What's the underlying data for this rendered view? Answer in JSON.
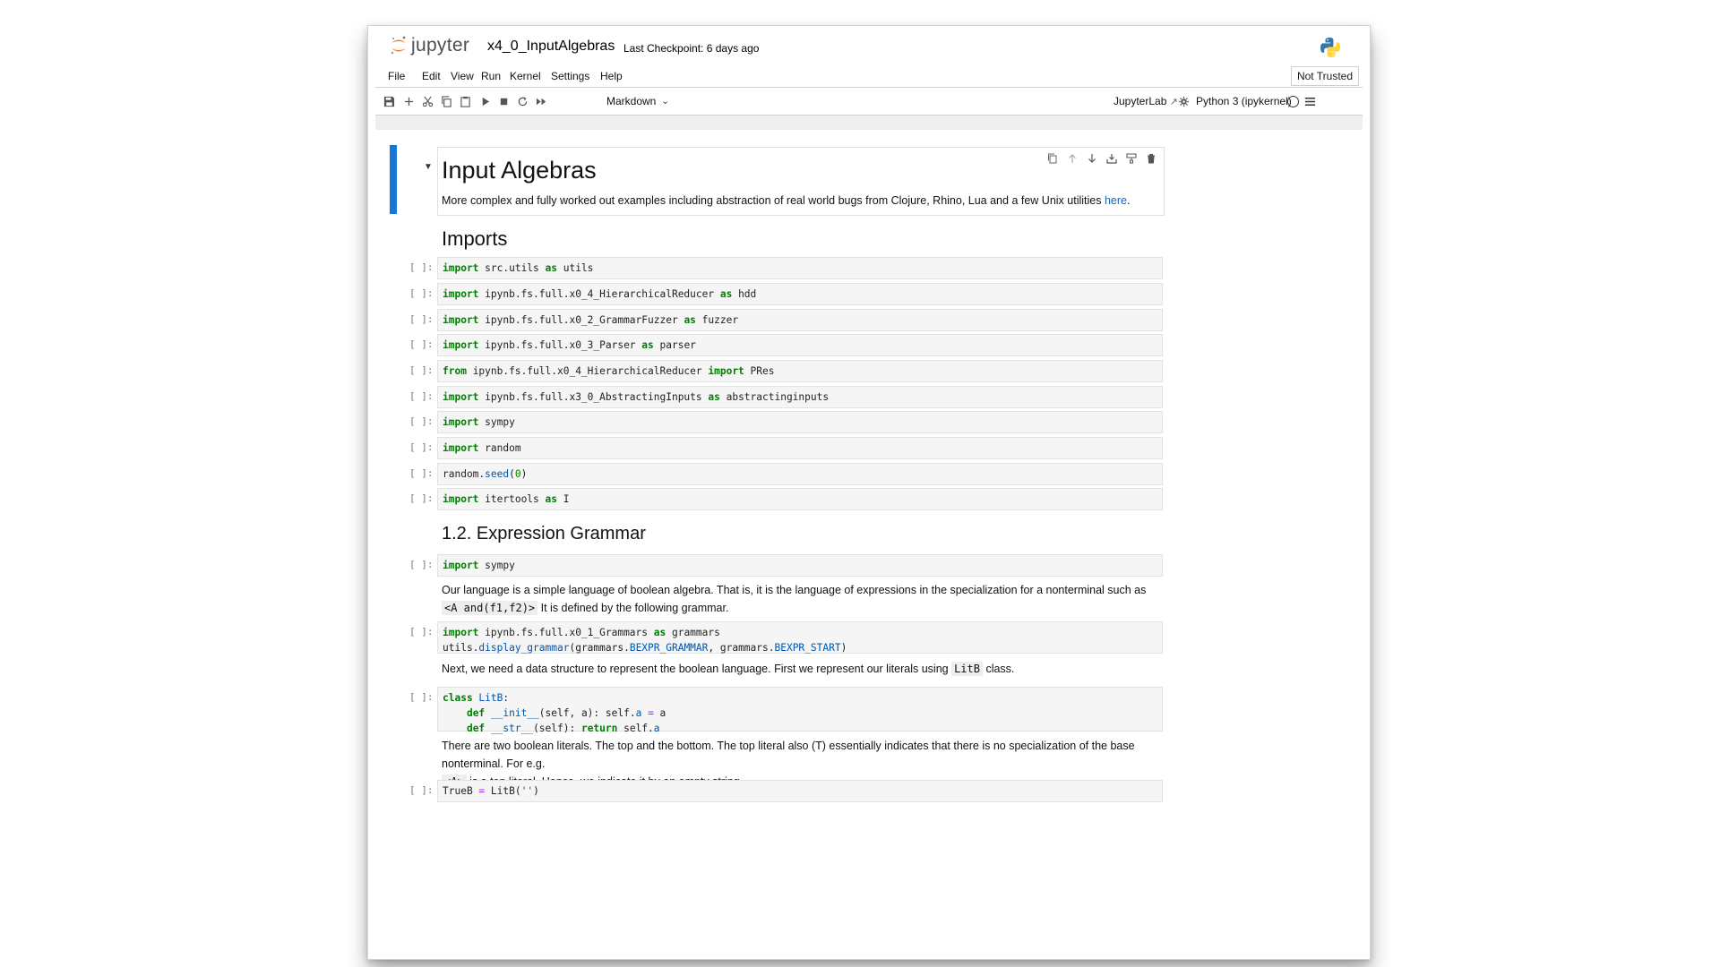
{
  "header": {
    "logo_text": "jupyter",
    "notebook_title": "x4_0_InputAlgebras",
    "checkpoint": "Last Checkpoint: 6 days ago"
  },
  "menu": {
    "items": [
      "File",
      "Edit",
      "View",
      "Run",
      "Kernel",
      "Settings",
      "Help"
    ],
    "trust_status": "Not Trusted"
  },
  "toolbar": {
    "cell_type": "Markdown",
    "jupyterlab_label": "JupyterLab",
    "kernel_name": "Python 3 (ipykernel)"
  },
  "cells": {
    "intro_heading": "Input Algebras",
    "intro_text": "More complex and fully worked out examples including abstraction of real world bugs from Clojure, Rhino, Lua and a few Unix utilities ",
    "intro_link": "here",
    "imports_heading": "Imports",
    "prompt": "[ ]:",
    "grammar_heading": "1.2. Expression Grammar",
    "lang_text_1": "Our language is a simple language of boolean algebra. That is, it is the language of expressions in the specialization for a nonterminal such as ",
    "lang_code": "<A and(f1,f2)>",
    "lang_text_2": " It is defined by the following grammar.",
    "next_text_1": "Next, we need a data structure to represent the boolean language. First we represent our literals using ",
    "next_code": "LitB",
    "next_text_2": " class.",
    "lit_text_1": "There are two boolean literals. The top and the bottom. The top literal also (T) essentially indicates that there is no specialization of the base nonterminal. For e.g.",
    "lit_code": "<A>",
    "lit_text_2": " is a top literal. Hence, we indicate it by an empty string."
  },
  "tokens": {
    "import": "import",
    "as": "as",
    "from": "from",
    "class": "class",
    "def": "def",
    "return": "return",
    "c1_mod": " src.utils ",
    "c1_alias": " utils",
    "c2_mod": " ipynb.fs.full.x0_4_HierarchicalReducer ",
    "c2_alias": " hdd",
    "c3_mod": " ipynb.fs.full.x0_2_GrammarFuzzer ",
    "c3_alias": " fuzzer",
    "c4_mod": " ipynb.fs.full.x0_3_Parser ",
    "c4_alias": " parser",
    "c5_mod": " ipynb.fs.full.x0_4_HierarchicalReducer ",
    "c5_name": " PRes",
    "c6_mod": " ipynb.fs.full.x3_0_AbstractingInputs ",
    "c6_alias": " abstractinginputs",
    "sympy": " sympy",
    "random": " random",
    "c9_obj": "random.",
    "c9_fn": "seed",
    "c9_open": "(",
    "c9_num": "0",
    "c9_close": ")",
    "c10_mod": " itertools ",
    "c10_alias": " I",
    "c12_mod": " ipynb.fs.full.x0_1_Grammars ",
    "c12_alias": " grammars",
    "c12_l2a": "utils.",
    "c12_fn": "display_grammar",
    "c12_l2b": "(grammars.",
    "c12_attr1": "BEXPR_GRAMMAR",
    "c12_l2c": ", grammars.",
    "c12_attr2": "BEXPR_START",
    "c12_l2d": ")",
    "c13_name": " LitB",
    "c13_colon": ":",
    "c13_init": " __init__",
    "c13_init_args": "(self, a): self.",
    "c13_attr_a": "a",
    "c13_eq": " = ",
    "c13_val": "a",
    "c13_str": " __str__",
    "c13_str_args": "(self): ",
    "c13_ret": " self.",
    "c14_var": "TrueB ",
    "c14_eq": "=",
    "c14_call": " LitB(",
    "c14_str": "''",
    "c14_close": ")"
  }
}
